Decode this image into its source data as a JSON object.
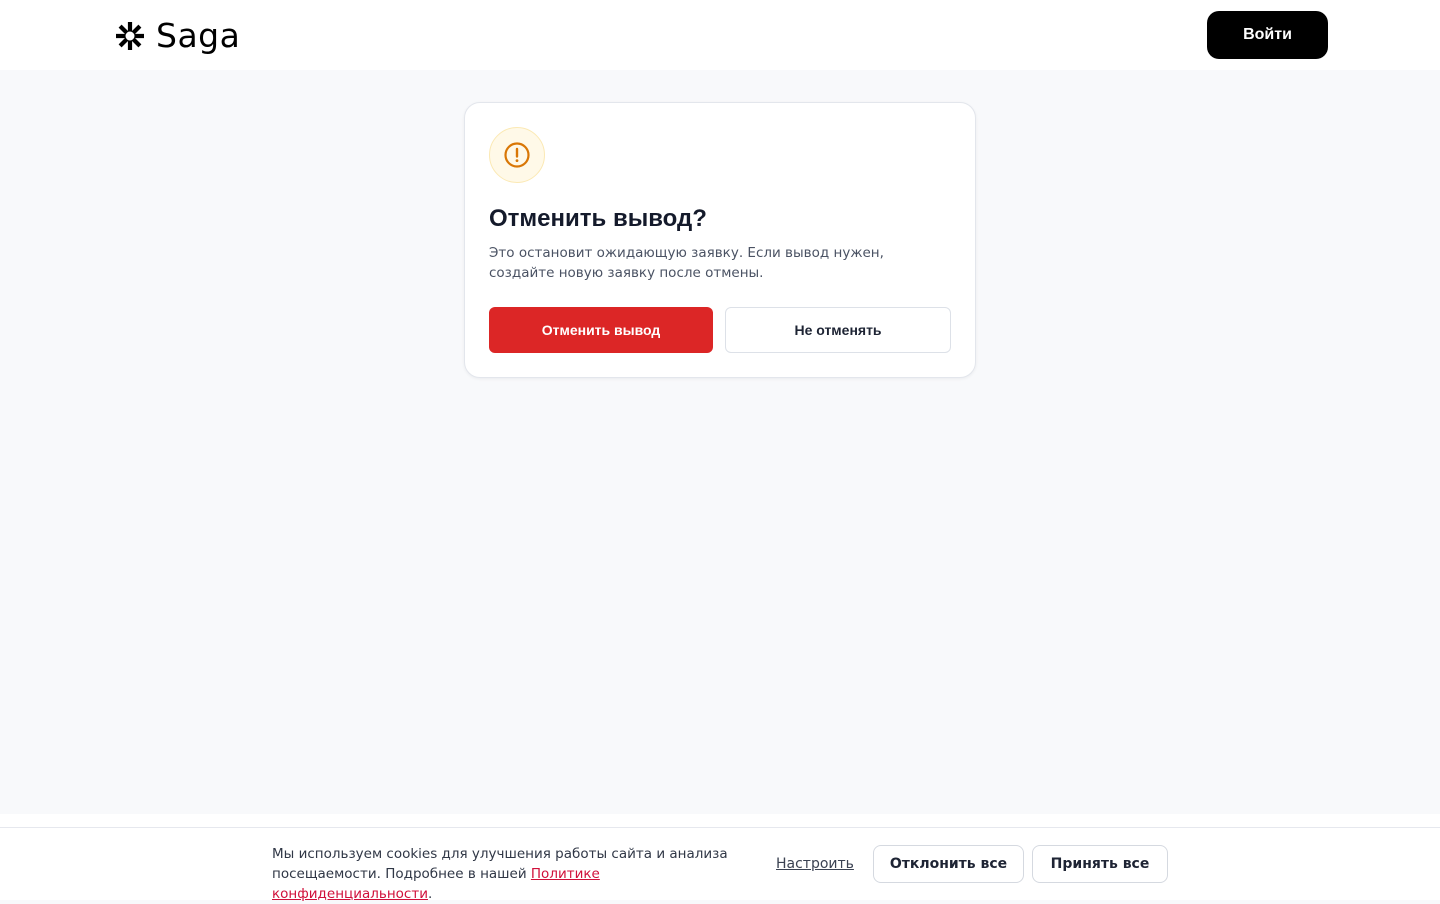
{
  "header": {
    "logo_text": "Saga",
    "login_label": "Войти"
  },
  "dialog": {
    "icon": "alert-circle-icon",
    "title": "Отменить вывод?",
    "description": "Это остановит ожидающую заявку. Если вывод нужен, создайте новую заявку после отмены.",
    "confirm_label": "Отменить вывод",
    "cancel_label": "Не отменять"
  },
  "cookie_banner": {
    "text_before_link": "Мы используем cookies для улучшения работы сайта и анализа посещаемости. Подробнее в нашей ",
    "link_text": "Политике конфиденциальности",
    "text_after_link": ".",
    "settings_label": "Настроить",
    "decline_label": "Отклонить все",
    "accept_label": "Принять все"
  },
  "colors": {
    "page_background": "#f8f9fb",
    "danger": "#dc2626",
    "warning_icon": "#d97706",
    "link": "#d0103a",
    "primary_dark": "#000000"
  }
}
